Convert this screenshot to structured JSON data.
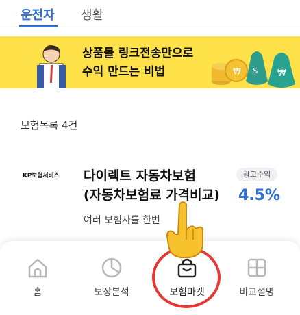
{
  "tabs": [
    {
      "label": "운전자"
    },
    {
      "label": "생활"
    }
  ],
  "banner": {
    "line1": "상품몰 링크전송만으로",
    "line2": "수익 만드는 비법"
  },
  "list": {
    "title": "보험목록 4건"
  },
  "item": {
    "brand": "KP보험서비스",
    "name_line1": "다이렉트 자동차보험",
    "name_line2": "(자동차보험료 가격비교)",
    "badge": "광고수익",
    "rate": "4.5%",
    "desc": "여러 보험사를 한번"
  },
  "bottom_nav": [
    {
      "label": "홈",
      "icon": "home-icon"
    },
    {
      "label": "보장분석",
      "icon": "pie-chart-icon"
    },
    {
      "label": "보험마켓",
      "icon": "shopping-bag-icon"
    },
    {
      "label": "비교설명",
      "icon": "grid-icon"
    }
  ],
  "colors": {
    "accent": "#2f6fd6",
    "banner": "#ffe14a",
    "highlight": "#e53935"
  }
}
